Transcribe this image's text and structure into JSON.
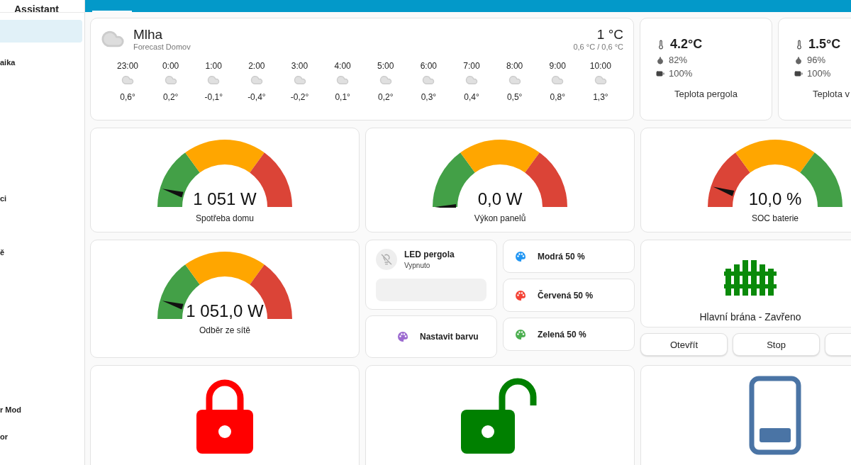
{
  "sidebar": {
    "title": "Assistant",
    "items": [
      {
        "selected": true
      },
      {
        "label": "aika",
        "selected": false
      },
      {
        "label": "ci",
        "selected": false
      },
      {
        "label": "ě",
        "selected": false
      },
      {
        "label": "r Mod",
        "selected": false
      },
      {
        "label": "or",
        "selected": false
      }
    ]
  },
  "weather": {
    "condition": "Mlha",
    "subtitle": "Forecast Domov",
    "temperature": "1 °C",
    "range": "0,6 °C / 0,6 °C",
    "forecast": [
      {
        "time": "23:00",
        "temp": "0,6°"
      },
      {
        "time": "0:00",
        "temp": "0,2°"
      },
      {
        "time": "1:00",
        "temp": "-0,1°"
      },
      {
        "time": "2:00",
        "temp": "-0,4°"
      },
      {
        "time": "3:00",
        "temp": "-0,2°"
      },
      {
        "time": "4:00",
        "temp": "0,1°"
      },
      {
        "time": "5:00",
        "temp": "0,2°"
      },
      {
        "time": "6:00",
        "temp": "0,3°"
      },
      {
        "time": "7:00",
        "temp": "0,4°"
      },
      {
        "time": "8:00",
        "temp": "0,5°"
      },
      {
        "time": "9:00",
        "temp": "0,8°"
      },
      {
        "time": "10:00",
        "temp": "1,3°"
      }
    ]
  },
  "sensors": [
    {
      "temperature": "4.2°C",
      "humidity": "82%",
      "battery": "100%",
      "name": "Teplota pergola"
    },
    {
      "temperature": "1.5°C",
      "humidity": "96%",
      "battery": "100%",
      "name": "Teplota v"
    }
  ],
  "gauges": [
    {
      "value": "1 051 W",
      "name": "Spotřeba domu",
      "level": 0.09,
      "segments": [
        {
          "color": "#43a047"
        },
        {
          "color": "#ffa600"
        },
        {
          "color": "#db4437"
        }
      ]
    },
    {
      "value": "0,0 W",
      "name": "Výkon panelů",
      "level": 0.0,
      "segments": [
        {
          "color": "#43a047"
        },
        {
          "color": "#ffa600"
        },
        {
          "color": "#db4437"
        }
      ]
    },
    {
      "value": "10,0 %",
      "name": "SOC baterie",
      "level": 0.1,
      "segments": [
        {
          "color": "#db4437"
        },
        {
          "color": "#ffa600"
        },
        {
          "color": "#43a047"
        }
      ]
    },
    {
      "value": "1 051,0 W",
      "name": "Odběr ze sítě",
      "level": 0.09,
      "segments": [
        {
          "color": "#43a047"
        },
        {
          "color": "#ffa600"
        },
        {
          "color": "#db4437"
        }
      ]
    }
  ],
  "light": {
    "name": "LED pergola",
    "state": "Vypnuto",
    "on": false,
    "level": 0
  },
  "set_color": {
    "label": "Nastavit barvu",
    "color": "#9c6ad0"
  },
  "color_scenes": [
    {
      "label": "Modrá 50 %",
      "color": "#2196f3"
    },
    {
      "label": "Červená 50 %",
      "color": "#f44336"
    },
    {
      "label": "Zelená 50 %",
      "color": "#4caf50"
    }
  ],
  "gate": {
    "label": "Hlavní brána - Zavřeno",
    "buttons": [
      {
        "label": "Otevřít"
      },
      {
        "label": "Stop"
      }
    ],
    "more_button": true
  },
  "tiles": [
    {
      "kind": "locked",
      "color": "#ff0000"
    },
    {
      "kind": "unlocked",
      "color": "#008000"
    },
    {
      "kind": "phone",
      "color": "#4a74a5"
    }
  ]
}
